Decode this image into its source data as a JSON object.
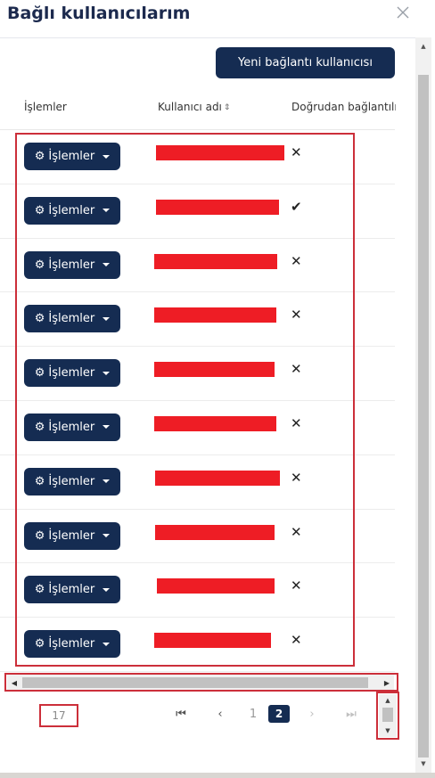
{
  "dialog": {
    "title": "Bağlı kullanıcılarım",
    "new_button_label": "Yeni bağlantı kullanıcısı"
  },
  "table": {
    "columns": {
      "actions": "İşlemler",
      "username": "Kullanıcı adı",
      "direct_link": "Doğrudan bağlantılı"
    },
    "action_button_label": "İşlemler",
    "rows": [
      {
        "username_redacted": true,
        "direct": "✕"
      },
      {
        "username_redacted": true,
        "direct": "✔"
      },
      {
        "username_redacted": true,
        "direct": "✕"
      },
      {
        "username_redacted": true,
        "direct": "✕"
      },
      {
        "username_redacted": true,
        "direct": "✕"
      },
      {
        "username_redacted": true,
        "direct": "✕"
      },
      {
        "username_redacted": true,
        "direct": "✕"
      },
      {
        "username_redacted": true,
        "direct": "✕"
      },
      {
        "username_redacted": true,
        "direct": "✕"
      },
      {
        "username_redacted": true,
        "direct": "✕"
      }
    ]
  },
  "pagination": {
    "page_size": "17",
    "first_icon": "⏮",
    "prev_icon": "‹",
    "pages": [
      "1",
      "2"
    ],
    "current_page": "2",
    "next_icon": "›",
    "last_icon": "⏭"
  },
  "icons": {
    "close": "close-icon",
    "gear": "gear-icon",
    "caret": "caret-down-icon",
    "sort": "sort-icon"
  },
  "colors": {
    "primary": "#152c52",
    "redaction": "#ee1d25",
    "highlight": "#cc2f3a"
  }
}
